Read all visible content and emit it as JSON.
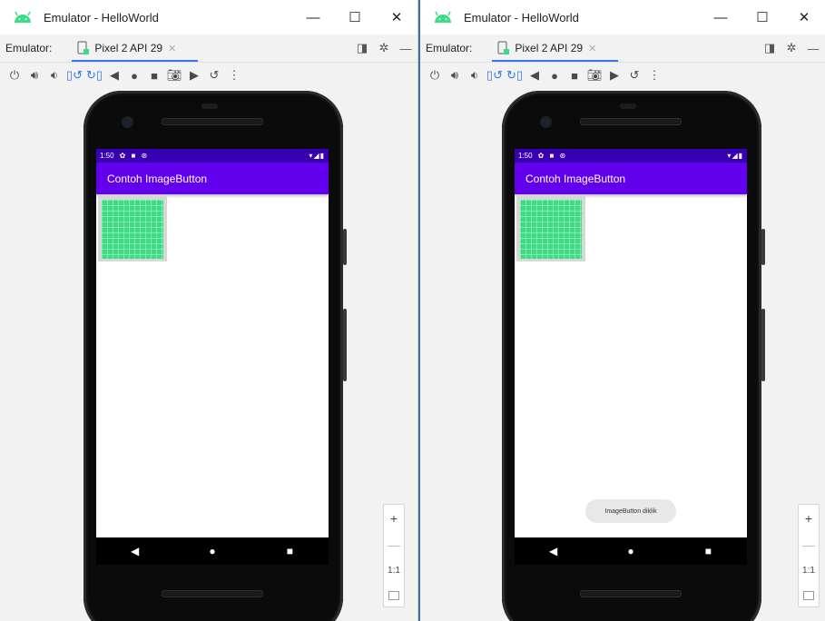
{
  "windows": [
    {
      "title": "Emulator - HelloWorld",
      "emulator_label": "Emulator:",
      "device_tab": "Pixel 2 API 29",
      "window_controls": [
        "minimize-icon",
        "maximize-icon",
        "close-icon"
      ],
      "toolbar_icons": [
        "power-icon",
        "volume-up-icon",
        "volume-down-icon",
        "rotate-left-icon",
        "rotate-right-icon",
        "back-icon",
        "home-icon",
        "overview-icon",
        "screenshot-icon",
        "screenrecord-icon",
        "snapshot-icon",
        "more-icon"
      ],
      "phone": {
        "status_time": "1:50",
        "status_icons": "✿ ■ ⊛",
        "status_right": "▾◢▮",
        "app_title": "Contoh ImageButton",
        "toast": ""
      },
      "zoom": {
        "zoom_in": "+",
        "zoom_out": "—",
        "actual": "1:1"
      }
    },
    {
      "title": "Emulator - HelloWorld",
      "emulator_label": "Emulator:",
      "device_tab": "Pixel 2 API 29",
      "window_controls": [
        "minimize-icon",
        "maximize-icon",
        "close-icon"
      ],
      "toolbar_icons": [
        "power-icon",
        "volume-up-icon",
        "volume-down-icon",
        "rotate-left-icon",
        "rotate-right-icon",
        "back-icon",
        "home-icon",
        "overview-icon",
        "screenshot-icon",
        "screenrecord-icon",
        "snapshot-icon",
        "more-icon"
      ],
      "phone": {
        "status_time": "1:50",
        "status_icons": "✿ ■ ⊛",
        "status_right": "▾◢▮",
        "app_title": "Contoh ImageButton",
        "toast": "ImageButton diklik"
      },
      "zoom": {
        "zoom_in": "+",
        "zoom_out": "—",
        "actual": "1:1"
      }
    }
  ],
  "colors": {
    "status_bar": "#3700b3",
    "app_bar": "#6200ee",
    "image": "#3ddc84",
    "tab_underline": "#3574f0"
  }
}
